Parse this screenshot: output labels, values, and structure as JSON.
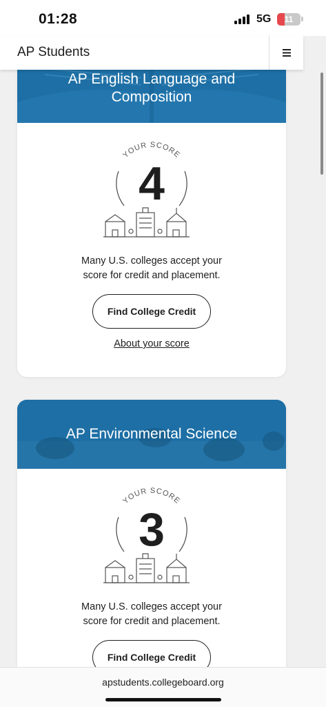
{
  "status_bar": {
    "time": "01:28",
    "network": "5G",
    "battery_level": "11"
  },
  "header": {
    "title": "AP Students",
    "menu_icon": "hamburger-menu-icon"
  },
  "cards": [
    {
      "course": "AP English Language and Composition",
      "score_label": "YOUR SCORE",
      "score": "4",
      "description_line1": "Many U.S. colleges accept your",
      "description_line2": "score for credit and placement.",
      "button_label": "Find College Credit",
      "link_label": "About your score"
    },
    {
      "course": "AP Environmental Science",
      "score_label": "YOUR SCORE",
      "score": "3",
      "description_line1": "Many U.S. colleges accept your",
      "description_line2": "score for credit and placement.",
      "button_label": "Find College Credit"
    }
  ],
  "browser": {
    "url": "apstudents.collegeboard.org"
  },
  "colors": {
    "banner_blue": "#1d6fa5",
    "battery_low": "#e5484d"
  }
}
